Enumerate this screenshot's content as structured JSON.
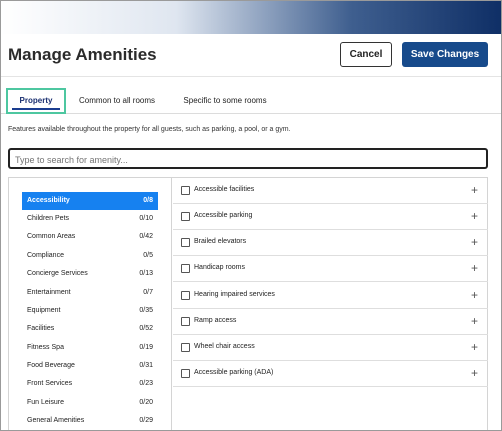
{
  "header": {
    "title": "Manage Amenities",
    "cancel_label": "Cancel",
    "save_label": "Save Changes"
  },
  "tabs": [
    {
      "label": "Property",
      "active": true
    },
    {
      "label": "Common to all rooms",
      "active": false
    },
    {
      "label": "Specific to some rooms",
      "active": false
    }
  ],
  "description": "Features available throughout the property for all guests, such as parking, a pool, or a gym.",
  "search": {
    "placeholder": "Type to search for amenity...",
    "value": ""
  },
  "categories": [
    {
      "label": "Accessibility",
      "count": "0/8",
      "selected": true
    },
    {
      "label": "Children Pets",
      "count": "0/10"
    },
    {
      "label": "Common Areas",
      "count": "0/42"
    },
    {
      "label": "Compliance",
      "count": "0/5"
    },
    {
      "label": "Concierge Services",
      "count": "0/13"
    },
    {
      "label": "Entertainment",
      "count": "0/7"
    },
    {
      "label": "Equipment",
      "count": "0/35"
    },
    {
      "label": "Facilities",
      "count": "0/52"
    },
    {
      "label": "Fitness Spa",
      "count": "0/19"
    },
    {
      "label": "Food Beverage",
      "count": "0/31"
    },
    {
      "label": "Front Services",
      "count": "0/23"
    },
    {
      "label": "Fun Leisure",
      "count": "0/20"
    },
    {
      "label": "General Amenities",
      "count": "0/29"
    }
  ],
  "amenities": [
    {
      "label": "Accessible facilities",
      "checked": false
    },
    {
      "label": "Accessible parking",
      "checked": false
    },
    {
      "label": "Brailed elevators",
      "checked": false
    },
    {
      "label": "Handicap rooms",
      "checked": false
    },
    {
      "label": "Hearing impaired services",
      "checked": false
    },
    {
      "label": "Ramp access",
      "checked": false
    },
    {
      "label": "Wheel chair access",
      "checked": false
    },
    {
      "label": "Accessible parking (ADA)",
      "checked": false
    }
  ],
  "icons": {
    "expand": "plus-icon",
    "checkbox": "checkbox-icon"
  },
  "colors": {
    "primary": "#174a8b",
    "selected": "#1681f0",
    "tab_focus": "#4dc7a0"
  }
}
